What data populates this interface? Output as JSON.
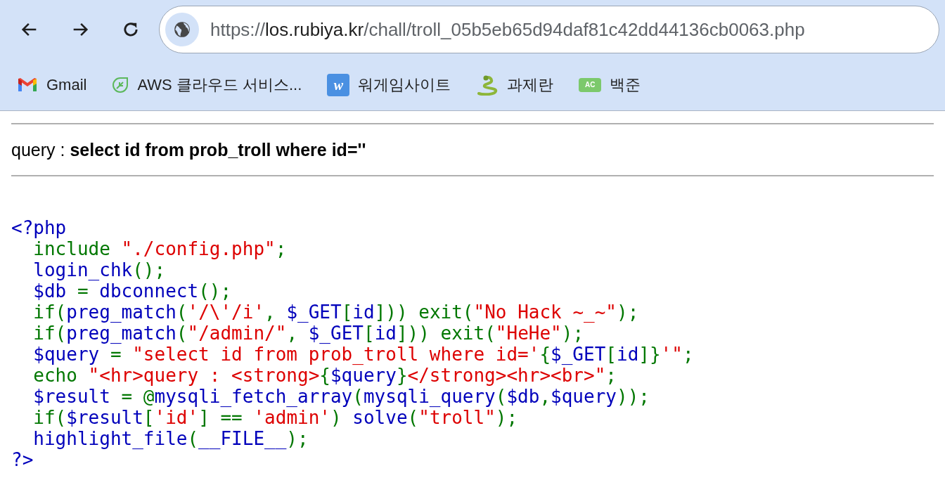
{
  "browser": {
    "url": {
      "scheme": "https://",
      "host": "los.rubiya.kr",
      "path": "/chall/troll_05b5eb65d94daf81c42dd44136cb0063.php"
    },
    "bookmarks": [
      {
        "kind": "gmail",
        "label": "Gmail"
      },
      {
        "kind": "leaf",
        "label": "AWS 클라우드 서비스..."
      },
      {
        "kind": "tile",
        "badge": "w",
        "label": "워게임사이트"
      },
      {
        "kind": "snake",
        "label": "과제란"
      },
      {
        "kind": "ac",
        "badge": "AC",
        "label": "백준"
      }
    ]
  },
  "page": {
    "query_line": "query : **select id from prob_troll where id=''**",
    "code_lines": [
      [
        {
          "kind": "default",
          "text": "<?php"
        }
      ],
      [
        {
          "kind": "keyword",
          "text": "  include "
        },
        {
          "kind": "string",
          "text": "\"./config.php\""
        },
        {
          "kind": "keyword",
          "text": ";"
        }
      ],
      [
        {
          "kind": "default",
          "text": "  login_chk"
        },
        {
          "kind": "keyword",
          "text": "();"
        }
      ],
      [
        {
          "kind": "default",
          "text": "  $db "
        },
        {
          "kind": "keyword",
          "text": "= "
        },
        {
          "kind": "default",
          "text": "dbconnect"
        },
        {
          "kind": "keyword",
          "text": "();"
        }
      ],
      [
        {
          "kind": "keyword",
          "text": "  if("
        },
        {
          "kind": "default",
          "text": "preg_match"
        },
        {
          "kind": "keyword",
          "text": "("
        },
        {
          "kind": "string",
          "text": "'/\\'/i'"
        },
        {
          "kind": "keyword",
          "text": ", "
        },
        {
          "kind": "default",
          "text": "$_GET"
        },
        {
          "kind": "keyword",
          "text": "["
        },
        {
          "kind": "default",
          "text": "id"
        },
        {
          "kind": "keyword",
          "text": "])) exit("
        },
        {
          "kind": "string",
          "text": "\"No Hack ~_~\""
        },
        {
          "kind": "keyword",
          "text": ");"
        }
      ],
      [
        {
          "kind": "keyword",
          "text": "  if("
        },
        {
          "kind": "default",
          "text": "preg_match"
        },
        {
          "kind": "keyword",
          "text": "("
        },
        {
          "kind": "string",
          "text": "\"/admin/\""
        },
        {
          "kind": "keyword",
          "text": ", "
        },
        {
          "kind": "default",
          "text": "$_GET"
        },
        {
          "kind": "keyword",
          "text": "["
        },
        {
          "kind": "default",
          "text": "id"
        },
        {
          "kind": "keyword",
          "text": "])) exit("
        },
        {
          "kind": "string",
          "text": "\"HeHe\""
        },
        {
          "kind": "keyword",
          "text": ");"
        }
      ],
      [
        {
          "kind": "default",
          "text": "  $query "
        },
        {
          "kind": "keyword",
          "text": "= "
        },
        {
          "kind": "string",
          "text": "\"select id from prob_troll where id='"
        },
        {
          "kind": "keyword",
          "text": "{"
        },
        {
          "kind": "default",
          "text": "$_GET"
        },
        {
          "kind": "keyword",
          "text": "["
        },
        {
          "kind": "default",
          "text": "id"
        },
        {
          "kind": "keyword",
          "text": "]}"
        },
        {
          "kind": "string",
          "text": "'\""
        },
        {
          "kind": "keyword",
          "text": ";"
        }
      ],
      [
        {
          "kind": "keyword",
          "text": "  echo "
        },
        {
          "kind": "string",
          "text": "\"<hr>query : <strong>"
        },
        {
          "kind": "keyword",
          "text": "{"
        },
        {
          "kind": "default",
          "text": "$query"
        },
        {
          "kind": "keyword",
          "text": "}"
        },
        {
          "kind": "string",
          "text": "</strong><hr><br>\""
        },
        {
          "kind": "keyword",
          "text": ";"
        }
      ],
      [
        {
          "kind": "default",
          "text": "  $result "
        },
        {
          "kind": "keyword",
          "text": "= @"
        },
        {
          "kind": "default",
          "text": "mysqli_fetch_array"
        },
        {
          "kind": "keyword",
          "text": "("
        },
        {
          "kind": "default",
          "text": "mysqli_query"
        },
        {
          "kind": "keyword",
          "text": "("
        },
        {
          "kind": "default",
          "text": "$db"
        },
        {
          "kind": "keyword",
          "text": ","
        },
        {
          "kind": "default",
          "text": "$query"
        },
        {
          "kind": "keyword",
          "text": "));"
        }
      ],
      [
        {
          "kind": "keyword",
          "text": "  if("
        },
        {
          "kind": "default",
          "text": "$result"
        },
        {
          "kind": "keyword",
          "text": "["
        },
        {
          "kind": "string",
          "text": "'id'"
        },
        {
          "kind": "keyword",
          "text": "] == "
        },
        {
          "kind": "string",
          "text": "'admin'"
        },
        {
          "kind": "keyword",
          "text": ") "
        },
        {
          "kind": "default",
          "text": "solve"
        },
        {
          "kind": "keyword",
          "text": "("
        },
        {
          "kind": "string",
          "text": "\"troll\""
        },
        {
          "kind": "keyword",
          "text": ");"
        }
      ],
      [
        {
          "kind": "default",
          "text": "  highlight_file"
        },
        {
          "kind": "keyword",
          "text": "("
        },
        {
          "kind": "default",
          "text": "__FILE__"
        },
        {
          "kind": "keyword",
          "text": ");"
        }
      ],
      [
        {
          "kind": "default",
          "text": "?>"
        }
      ]
    ]
  }
}
